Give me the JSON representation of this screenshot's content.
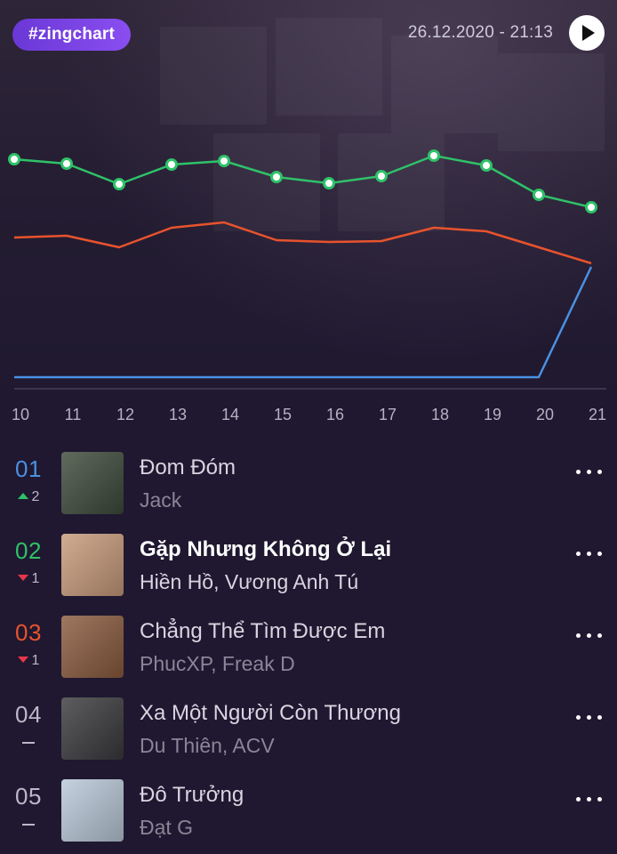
{
  "header": {
    "tag": "#zingchart",
    "datetime": "26.12.2020 - 21:13",
    "play_icon": "play-icon"
  },
  "chart_data": {
    "type": "line",
    "x": [
      "10",
      "11",
      "12",
      "13",
      "14",
      "15",
      "16",
      "17",
      "18",
      "19",
      "20",
      "21"
    ],
    "series": [
      {
        "color": "#2fc269",
        "markers": true,
        "values": [
          179,
          184,
          207,
          185,
          181,
          199,
          206,
          198,
          175,
          186,
          219,
          233
        ]
      },
      {
        "color": "#e8532d",
        "markers": false,
        "values": [
          267,
          265,
          278,
          256,
          250,
          270,
          272,
          271,
          256,
          260,
          278,
          296
        ]
      },
      {
        "color": "#4a90e2",
        "markers": false,
        "values": [
          424,
          424,
          424,
          424,
          424,
          424,
          424,
          424,
          424,
          424,
          424,
          300
        ]
      }
    ],
    "note_y_inverted": "values are relative chart-position units (higher number = lower rank position)",
    "xlabel": "",
    "ylabel": "",
    "grid": false,
    "legend": "none"
  },
  "rows": [
    {
      "rank": "01",
      "rank_color": "#4a90e2",
      "move": "up",
      "move_val": "2",
      "title": "Đom Đóm",
      "artist": "Jack",
      "title_style": "normal",
      "artist_style": "dim"
    },
    {
      "rank": "02",
      "rank_color": "#2fc269",
      "move": "down",
      "move_val": "1",
      "title": "Gặp Nhưng Không Ở Lại",
      "artist": "Hiền Hồ, Vương Anh Tú",
      "title_style": "strong",
      "artist_style": "light"
    },
    {
      "rank": "03",
      "rank_color": "#e8532d",
      "move": "down",
      "move_val": "1",
      "title": "Chẳng Thể Tìm Được Em",
      "artist": "PhucXP, Freak D",
      "title_style": "normal",
      "artist_style": "dim"
    },
    {
      "rank": "04",
      "rank_color": "#bdb7c8",
      "move": "none",
      "move_val": "",
      "title": "Xa Một Người Còn Thương",
      "artist": "Du Thiên, ACV",
      "title_style": "normal",
      "artist_style": "dim"
    },
    {
      "rank": "05",
      "rank_color": "#bdb7c8",
      "move": "none",
      "move_val": "",
      "title": "Đô Trưởng",
      "artist": "Đạt G",
      "title_style": "normal",
      "artist_style": "dim"
    }
  ],
  "covers": [
    {
      "name": "cover-dom-dom",
      "bg": "#3d4a3a"
    },
    {
      "name": "cover-gap-nhung-khong-o-lai",
      "bg": "#c79a7a"
    },
    {
      "name": "cover-chang-the-tim-duoc-em",
      "bg": "#8a5a3d"
    },
    {
      "name": "cover-xa-mot-nguoi-con-thuong",
      "bg": "#3a3a3e"
    },
    {
      "name": "cover-do-truong",
      "bg": "#b9c8d8"
    }
  ],
  "more_icon": "more-dots-icon"
}
